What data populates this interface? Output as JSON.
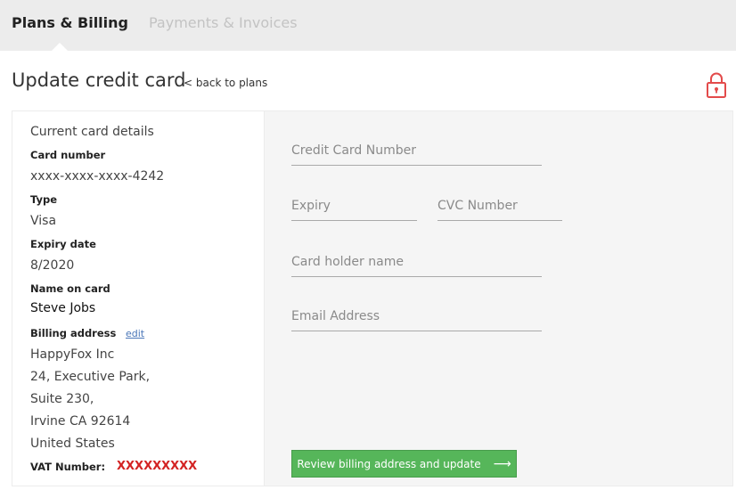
{
  "tabs": {
    "active": "Plans & Billing",
    "inactive": "Payments & Invoices"
  },
  "header": {
    "title": "Update credit card",
    "back_link": "< back to plans"
  },
  "current_card": {
    "heading": "Current card details",
    "card_number_label": "Card number",
    "card_number": "xxxx-xxxx-xxxx-4242",
    "type_label": "Type",
    "type": "Visa",
    "expiry_label": "Expiry date",
    "expiry": "8/2020",
    "name_label": "Name on card",
    "name": "Steve Jobs",
    "billing_label": "Billing address",
    "edit_link": "edit",
    "address": [
      "HappyFox Inc",
      "24, Executive Park,",
      "Suite 230,",
      "Irvine CA 92614",
      "United States"
    ],
    "vat_label": "VAT Number:",
    "vat_value": "XXXXXXXXX"
  },
  "form": {
    "card_number_placeholder": "Credit Card Number",
    "expiry_placeholder": "Expiry",
    "cvc_placeholder": "CVC Number",
    "holder_placeholder": "Card holder name",
    "email_placeholder": "Email Address",
    "submit_label": "Review billing address and update",
    "submit_arrow": "⟶"
  },
  "colors": {
    "accent_green": "#56b65a",
    "lock_red": "#e34b4b",
    "vat_red": "#d32323",
    "link_blue": "#4a76b8"
  },
  "icons": {
    "lock": "lock-icon",
    "arrow": "arrow-right-icon"
  }
}
